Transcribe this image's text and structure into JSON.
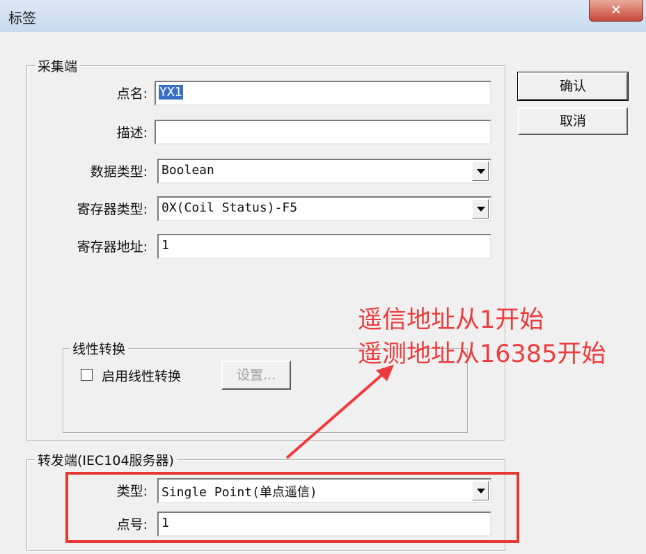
{
  "window": {
    "title": "标签",
    "close_glyph": "✕"
  },
  "collector": {
    "group_title": "采集端",
    "point_name_label": "点名:",
    "point_name_value": "YX1",
    "description_label": "描述:",
    "description_value": "",
    "data_type_label": "数据类型:",
    "data_type_value": "Boolean",
    "register_type_label": "寄存器类型:",
    "register_type_value": "0X(Coil Status)-F5",
    "register_address_label": "寄存器地址:",
    "register_address_value": "1"
  },
  "linear": {
    "group_title": "线性转换",
    "enable_label": "启用线性转换",
    "enabled": false,
    "settings_button": "设置..."
  },
  "forwarder": {
    "group_title": "转发端(IEC104服务器)",
    "type_label": "类型:",
    "type_value": "Single Point(单点遥信)",
    "point_no_label": "点号:",
    "point_no_value": "1"
  },
  "buttons": {
    "ok": "确认",
    "cancel": "取消"
  },
  "annotation": {
    "line1": "遥信地址从1开始",
    "line2": "遥测地址从16385开始",
    "color": "#ee3b3b"
  }
}
